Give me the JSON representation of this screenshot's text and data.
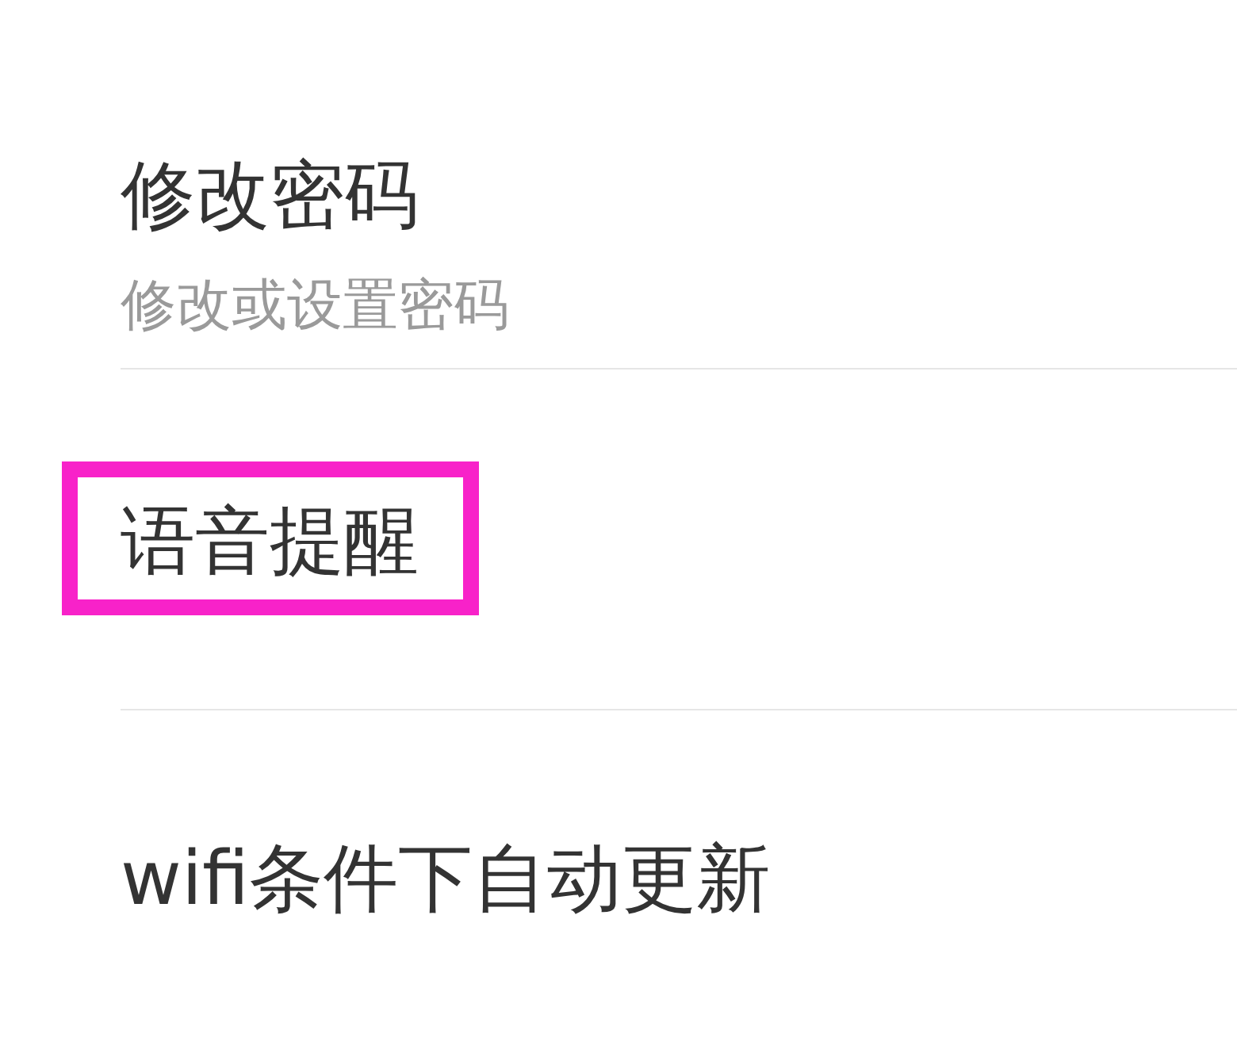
{
  "settings": {
    "items": [
      {
        "title": "修改密码",
        "subtitle": "修改或设置密码",
        "highlighted": false
      },
      {
        "title": "语音提醒",
        "highlighted": true
      },
      {
        "title": "wifi条件下自动更新",
        "highlighted": false
      }
    ]
  }
}
